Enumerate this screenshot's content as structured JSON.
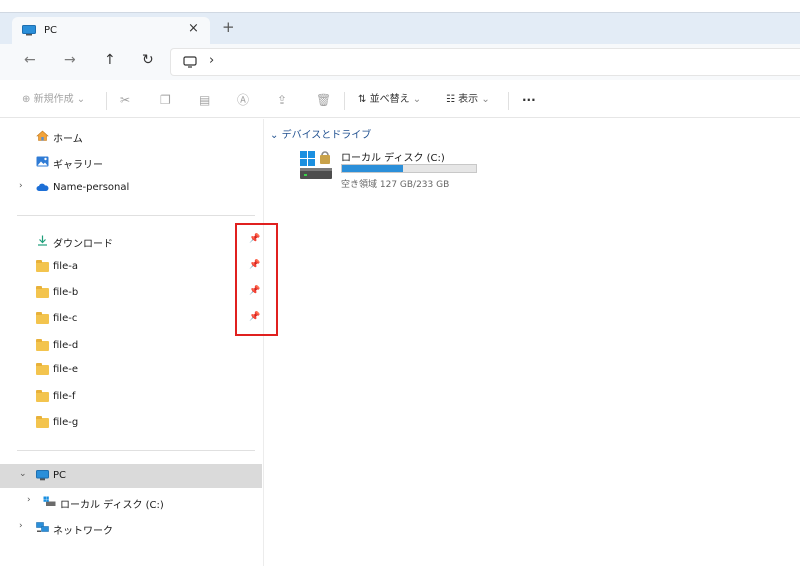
{
  "colors": {
    "accent": "#2b8fd9",
    "highlight": "#e0201f",
    "folder": "#f3c44e",
    "onedrive": "#1d6fd6"
  },
  "tab": {
    "title": "PC",
    "close": "×",
    "new": "+",
    "icon": "monitor-icon"
  },
  "nav": {
    "back": "←",
    "forward": "→",
    "up": "↑",
    "refresh": "↻",
    "chevron": "›"
  },
  "toolbar": {
    "new_label": "新規作成",
    "sort_label": "並べ替え",
    "view_label": "表示",
    "more": "···"
  },
  "sidebar": {
    "home": "ホーム",
    "gallery": "ギャラリー",
    "onedrive": "Name-personal",
    "pinned": [
      {
        "label": "ダウンロード",
        "icon": "download-icon",
        "pinned": true
      },
      {
        "label": "file-a",
        "pinned": true
      },
      {
        "label": "file-b",
        "pinned": true
      },
      {
        "label": "file-c",
        "pinned": true
      },
      {
        "label": "file-d",
        "pinned": false
      },
      {
        "label": "file-e",
        "pinned": false
      },
      {
        "label": "file-f",
        "pinned": false
      },
      {
        "label": "file-g",
        "pinned": false
      }
    ],
    "pc": "PC",
    "local_disk": "ローカル ディスク (C:)",
    "network": "ネットワーク"
  },
  "main": {
    "group_header": "デバイスとドライブ",
    "drive": {
      "name": "ローカル ディスク (C:)",
      "free_text": "空き領域 127 GB/233 GB",
      "used_fraction": 0.455
    }
  }
}
